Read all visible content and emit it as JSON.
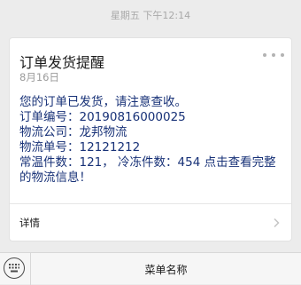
{
  "timestamp": "星期五 下午12:14",
  "card": {
    "title": "订单发货提醒",
    "date": "8月16日",
    "intro": "您的订单已发货，请注意查收。",
    "order_number_label": "订单编号：",
    "order_number": "20190816000025",
    "logistics_company_label": "物流公司：",
    "logistics_company": "龙邦物流",
    "tracking_number_label": "物流单号：",
    "tracking_number": "12121212",
    "summary_line1": "常温件数：121，  冷冻件数：454  点击查看完整",
    "summary_line2": "的物流信息！",
    "detail_label": "详情"
  },
  "bottom_bar": {
    "menu_label": "菜单名称"
  },
  "colors": {
    "accent": "#173177",
    "background": "#ececec"
  },
  "icons": [
    "more-icon",
    "chevron-right-icon",
    "keyboard-icon"
  ]
}
